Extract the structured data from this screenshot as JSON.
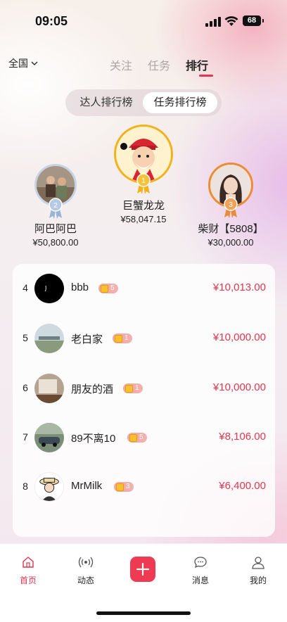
{
  "status": {
    "time": "09:05",
    "battery": "68"
  },
  "header": {
    "region": "全国",
    "tabs": [
      "关注",
      "任务",
      "排行"
    ],
    "active_tab": "排行"
  },
  "toggle": {
    "options": [
      "达人排行榜",
      "任务排行榜"
    ],
    "selected": "任务排行榜"
  },
  "podium": [
    {
      "rank": "1",
      "name": "巨蟹龙龙",
      "amount": "¥58,047.15"
    },
    {
      "rank": "2",
      "name": "阿巴阿巴",
      "amount": "¥50,800.00"
    },
    {
      "rank": "3",
      "name": "柴财【5808】",
      "amount": "¥30,000.00"
    }
  ],
  "list": [
    {
      "rank": "4",
      "name": "bbb",
      "badge": "5",
      "amount": "¥10,013.00"
    },
    {
      "rank": "5",
      "name": "老白家",
      "badge": "1",
      "amount": "¥10,000.00"
    },
    {
      "rank": "6",
      "name": "朋友的酒",
      "badge": "1",
      "amount": "¥10,000.00"
    },
    {
      "rank": "7",
      "name": "89不离10",
      "badge": "5",
      "amount": "¥8,106.00"
    },
    {
      "rank": "8",
      "name": "MrMilk",
      "badge": "3",
      "amount": "¥6,400.00"
    }
  ],
  "tabbar": [
    {
      "label": "首页",
      "icon": "home-icon"
    },
    {
      "label": "动态",
      "icon": "broadcast-icon"
    },
    {
      "label": "",
      "icon": "plus-icon"
    },
    {
      "label": "消息",
      "icon": "chat-icon"
    },
    {
      "label": "我的",
      "icon": "user-icon"
    }
  ],
  "colors": {
    "accent": "#e2364f",
    "gold": "#f3b21c",
    "silver": "#9bb4d6",
    "bronze": "#e88b3a"
  }
}
